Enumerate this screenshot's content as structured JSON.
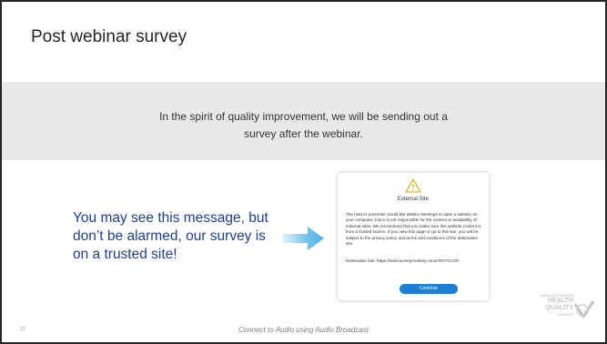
{
  "slide": {
    "title": "Post webinar survey",
    "banner": {
      "line1": "In the spirit of quality improvement, we will be sending out a",
      "line2": "survey after the webinar."
    },
    "callout": "You may see this message, but don’t be alarmed, our survey is on a trusted site!",
    "footer": "Connect to Audio using Audio Broadcast",
    "page_number": "22"
  },
  "dialog": {
    "icon": "warning-triangle-icon",
    "title": "External Site",
    "body": "The host or presenter would like Webex Meetings to open a website on your computer. Cisco is not responsible for the content or availability of external sites. We recommend that you make sure this website content is from a trusted source. If you view this page or go to this site, you will be subject to the privacy policy and terms and conditions of the destination site.",
    "destination_label": "Destination site:",
    "destination_url": "https://www.surveymonkey.com/r/XGTCCXH",
    "button_label": "Continue"
  },
  "logo": {
    "line1": "SASKATCHEWAN",
    "line2": "HEALTH",
    "line3": "QUALITY",
    "line4": "COUNCIL"
  },
  "colors": {
    "callout_text": "#1f3f8f",
    "arrow": "#4fb3e8",
    "button": "#1b7fd6",
    "band": "#e9e9e9"
  }
}
